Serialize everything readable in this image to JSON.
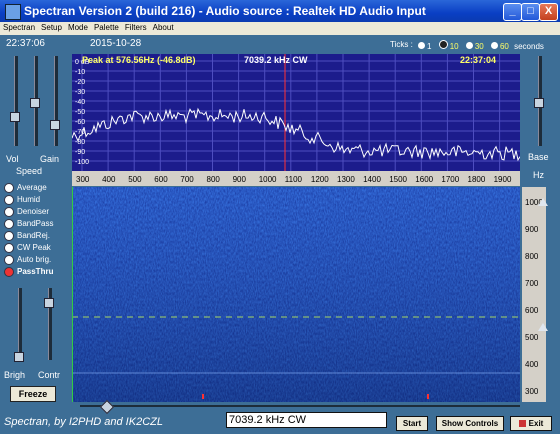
{
  "window": {
    "title": "Spectran Version 2 (build 216) - Audio source  :  Realtek HD Audio Input",
    "minimize": "_",
    "maximize": "□",
    "close": "X"
  },
  "menu": [
    "Spectran",
    "Setup",
    "Mode",
    "Palette",
    "Filters",
    "About"
  ],
  "header": {
    "time": "22:37:06",
    "date": "2015-10-28",
    "ticks_label": "Ticks :",
    "tick_options": [
      "1",
      "10",
      "30",
      "60"
    ],
    "tick_selected": "10",
    "ticks_unit": "seconds"
  },
  "left_panel": {
    "vol_label": "Vol",
    "gain_label": "Gain",
    "speed_label": "Speed",
    "vol_level": 0.62,
    "gain_level": 0.45,
    "options": [
      {
        "label": "Average",
        "on": false
      },
      {
        "label": "Humid",
        "on": false
      },
      {
        "label": "Denoiser",
        "on": false
      },
      {
        "label": "BandPass",
        "on": false
      },
      {
        "label": "BandRej.",
        "on": false
      },
      {
        "label": "CW Peak",
        "on": false
      },
      {
        "label": "Auto brig.",
        "on": false
      },
      {
        "label": "PassThru",
        "on": true
      }
    ],
    "brigh_label": "Brigh",
    "contr_label": "Contr",
    "freeze_label": "Freeze"
  },
  "spectrum": {
    "peak_text": "Peak at    576.56Hz (-46.8dB)",
    "tuned_text": "7039.2 kHz CW",
    "time_text": "22:37:04",
    "db_labels": [
      "0 dB",
      "-10",
      "-20",
      "-30",
      "-40",
      "-50",
      "-60",
      "-70",
      "-80",
      "-90",
      "-100"
    ],
    "freq_labels": [
      "300",
      "400",
      "500",
      "600",
      "700",
      "800",
      "900",
      "1000",
      "1100",
      "1200",
      "1300",
      "1400",
      "1500",
      "1600",
      "1700",
      "1800",
      "1900"
    ]
  },
  "right_panel": {
    "base_label": "Base",
    "unit_label": "Hz",
    "scale": [
      "1000",
      "900",
      "800",
      "700",
      "600",
      "500",
      "400",
      "300"
    ]
  },
  "bottom": {
    "credit": "Spectran, by I2PHD and IK2CZL",
    "status": "7039.2 kHz CW",
    "start_label": "Start",
    "show_controls_label": "Show Controls",
    "exit_label": "Exit"
  },
  "colors": {
    "panel": "#3d6e96",
    "spectrum_bg": "#1c1c8c",
    "waterfall_bg": "#16389a",
    "peak_text": "#ffff66",
    "marker": "#ff3030"
  }
}
